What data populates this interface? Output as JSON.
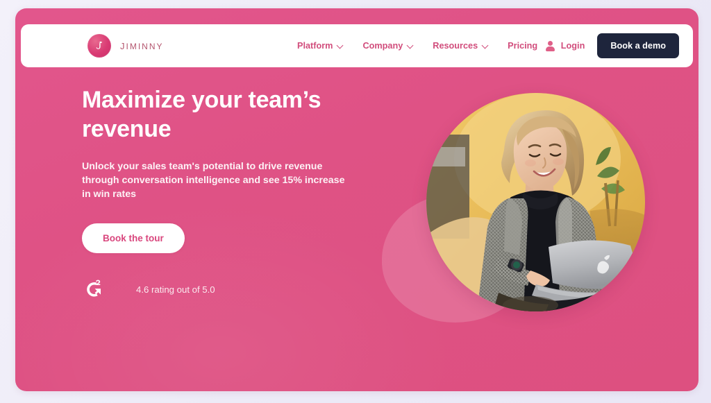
{
  "brand": {
    "name": "Jiminny",
    "mark_icon": "jiminny-j-logo-icon",
    "mark_color": "#d93a73"
  },
  "nav": {
    "items": [
      {
        "label": "Platform",
        "has_dropdown": true,
        "icon": "chevron-down-icon"
      },
      {
        "label": "Company",
        "has_dropdown": true,
        "icon": "chevron-down-icon"
      },
      {
        "label": "Resources",
        "has_dropdown": true,
        "icon": "chevron-down-icon"
      },
      {
        "label": "Pricing",
        "has_dropdown": false,
        "icon": ""
      }
    ],
    "link_color": "#d14d7c"
  },
  "header_right": {
    "login_label": "Login",
    "login_icon": "user-icon",
    "demo_button_label": "Book a demo",
    "demo_button_color": "#1e253c"
  },
  "hero": {
    "title": "Maximize your team’s revenue",
    "subtitle": "Unlock your sales team's potential to drive revenue through conversation intelligence and see 15% increase in win rates",
    "cta_label": "Book the tour",
    "background_color": "#df5285",
    "page_background_color": "#eceaf6"
  },
  "rating": {
    "badge_icon": "g2-logo-icon",
    "text": "4.6 rating out of 5.0"
  },
  "visual": {
    "portrait_alt": "Smiling woman in grey tweed blazer working on a laptop",
    "blob_shape": "decorative-blob"
  }
}
